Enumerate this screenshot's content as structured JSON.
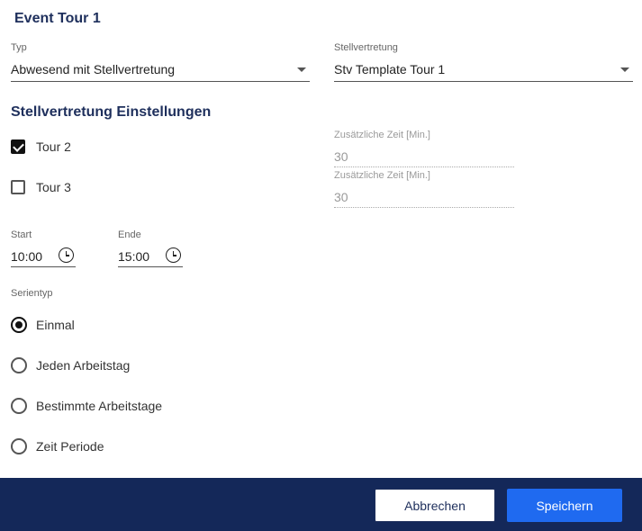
{
  "title": "Event Tour 1",
  "typ": {
    "label": "Typ",
    "value": "Abwesend mit Stellvertretung"
  },
  "stellvertretung": {
    "label": "Stellvertretung",
    "value": "Stv Template Tour 1"
  },
  "settings_title": "Stellvertretung Einstellungen",
  "tours": [
    {
      "label": "Tour 2",
      "checked": true,
      "extra_time_label": "Zusätzliche Zeit [Min.]",
      "extra_time_value": "30"
    },
    {
      "label": "Tour 3",
      "checked": false,
      "extra_time_label": "Zusätzliche Zeit [Min.]",
      "extra_time_value": "30"
    }
  ],
  "start": {
    "label": "Start",
    "value": "10:00"
  },
  "ende": {
    "label": "Ende",
    "value": "15:00"
  },
  "serientyp": {
    "label": "Serientyp",
    "options": [
      {
        "label": "Einmal",
        "selected": true
      },
      {
        "label": "Jeden Arbeitstag",
        "selected": false
      },
      {
        "label": "Bestimmte Arbeitstage",
        "selected": false
      },
      {
        "label": "Zeit Periode",
        "selected": false
      }
    ]
  },
  "footer": {
    "cancel_label": "Abbrechen",
    "save_label": "Speichern"
  },
  "colors": {
    "header_text": "#1e2f5c",
    "footer_bg": "#142859",
    "primary": "#1f6af0"
  }
}
